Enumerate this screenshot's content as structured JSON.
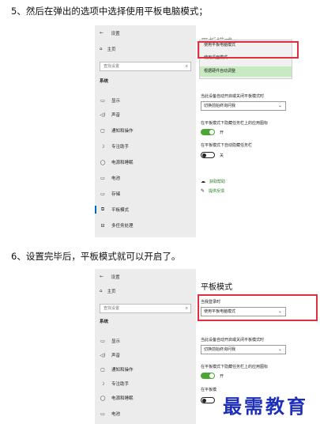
{
  "step5_text": "5、然后在弹出的选项中选择使用平板电脑模式；",
  "step6_text": "6、设置完毕后，平板模式就可以开启了。",
  "window": {
    "back_glyph": "←",
    "title": "设置",
    "home_label": "主页",
    "search_placeholder": "查找设置",
    "category": "系统",
    "nav_items": [
      {
        "icon": "▭",
        "label": "显示"
      },
      {
        "icon": "◁)",
        "label": "声音"
      },
      {
        "icon": "▢",
        "label": "通知和操作"
      },
      {
        "icon": "☽",
        "label": "专注助手"
      },
      {
        "icon": "◯",
        "label": "电源和睡眠"
      },
      {
        "icon": "▭",
        "label": "电池"
      },
      {
        "icon": "▭",
        "label": "存储"
      },
      {
        "icon": "⧉",
        "label": "平板模式"
      },
      {
        "icon": "⊟",
        "label": "多任务处理"
      }
    ]
  },
  "screen1": {
    "title_partial": "平板模式",
    "popup_options": [
      "使用平板电脑模式",
      "使用桌面模式",
      "根据硬件自动调整"
    ],
    "label_prompt": "当此设备自动开启或关闭平板模式时",
    "dropdown_prompt": "切换前始终询问我",
    "label_hide_icons": "在平板模式下隐藏任务栏上的应用图标",
    "toggle_on_text": "开",
    "label_autohide": "在平板模式下自动隐藏任务栏",
    "toggle_off_text": "关",
    "help_link": "获取帮助",
    "feedback_link": "提供反馈"
  },
  "screen2": {
    "title": "平板模式",
    "label_signin": "当我登录时",
    "dropdown_signin": "使用平板电脑模式",
    "label_prompt": "当此设备自动开启或关闭平板模式时",
    "dropdown_prompt": "切换前始终询问我",
    "label_hide_icons": "在平板模式下隐藏任务栏上的应用图标",
    "toggle_on_text": "开",
    "label_autohide_partial": "在平板模"
  },
  "watermark": "最需教育",
  "colors": {
    "highlight": "#c7eac0",
    "redbox": "#e0303c",
    "toggle_on": "#4aa832",
    "watermark": "#1e2fb8"
  }
}
